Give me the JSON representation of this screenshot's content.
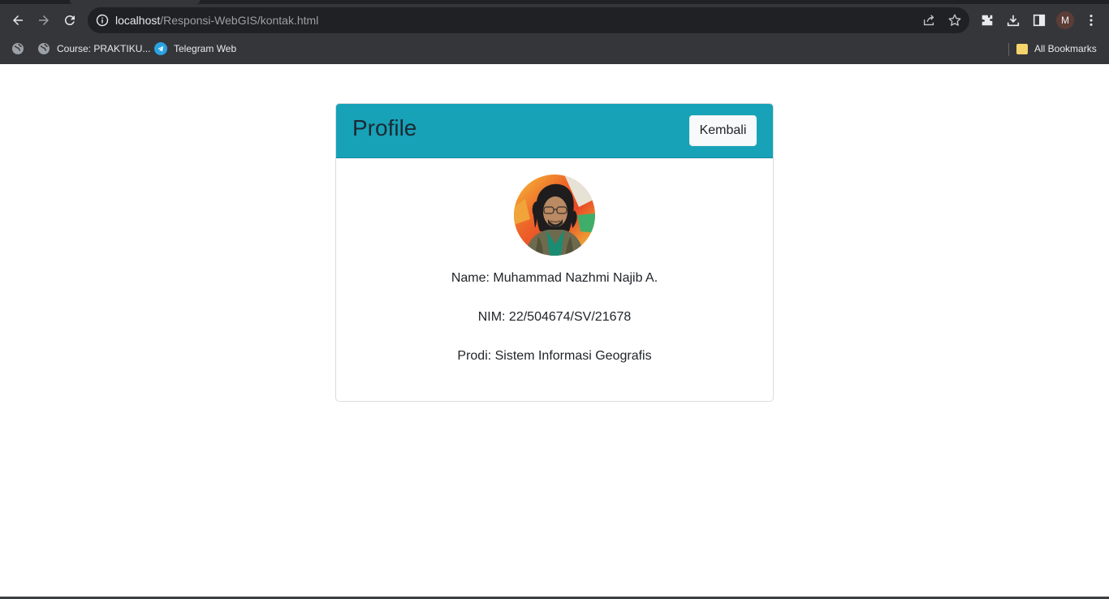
{
  "browser": {
    "url_host": "localhost",
    "url_path": "/Responsi-WebGIS/kontak.html",
    "avatar_letter": "M",
    "bookmarks": [
      {
        "label": "Course: PRAKTIKU..."
      },
      {
        "label": "Telegram Web"
      }
    ],
    "all_bookmarks_label": "All Bookmarks"
  },
  "card": {
    "title": "Profile",
    "back_button_label": "Kembali",
    "name_line": "Name: Muhammad Nazhmi Najib A.",
    "nim_line": "NIM: 22/504674/SV/21678",
    "prodi_line": "Prodi: Sistem Informasi Geografis"
  },
  "colors": {
    "header_bg": "#17a2b8",
    "chrome_bg": "#35363a"
  }
}
